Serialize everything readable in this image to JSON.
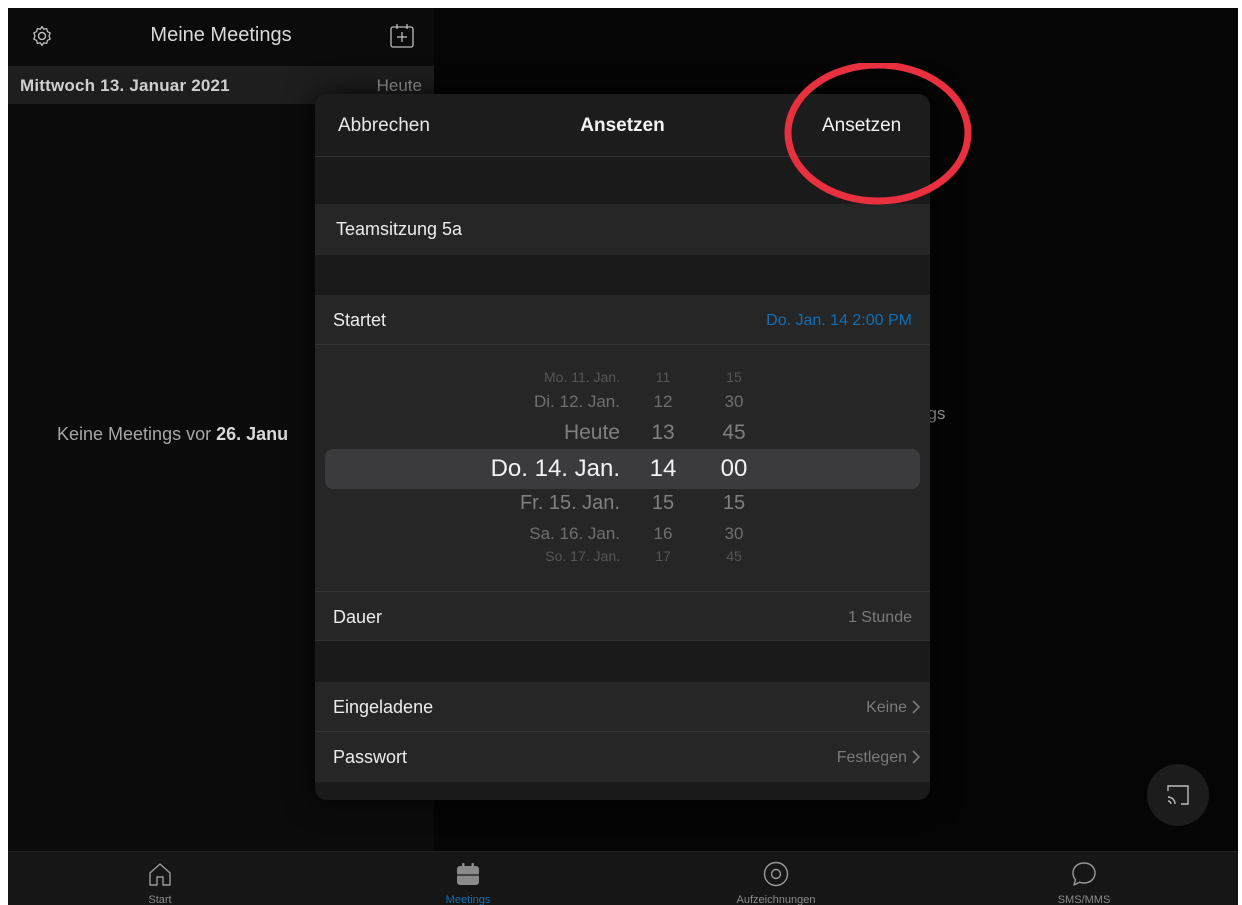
{
  "left_panel": {
    "title": "Meine Meetings",
    "date_header": "Mittwoch 13. Januar 2021",
    "today_label": "Heute",
    "empty_prefix": "Keine Meetings vor ",
    "empty_date": "26. Janu"
  },
  "right_panel": {
    "partial_text": "ngs"
  },
  "modal": {
    "cancel_label": "Abbrechen",
    "title": "Ansetzen",
    "confirm_label": "Ansetzen",
    "topic": "Teamsitzung 5a",
    "start_label": "Startet",
    "start_value": "Do. Jan. 14 2:00 PM",
    "picker": {
      "dates": [
        "Mo. 11. Jan.",
        "Di. 12. Jan.",
        "Heute",
        "Do. 14. Jan.",
        "Fr. 15. Jan.",
        "Sa. 16. Jan.",
        "So. 17. Jan."
      ],
      "hours": [
        "11",
        "12",
        "13",
        "14",
        "15",
        "16",
        "17"
      ],
      "minutes": [
        "15",
        "30",
        "45",
        "00",
        "15",
        "30",
        "45"
      ],
      "selected_index": 3
    },
    "duration_label": "Dauer",
    "duration_value": "1 Stunde",
    "invitees_label": "Eingeladene",
    "invitees_value": "Keine",
    "password_label": "Passwort",
    "password_value": "Festlegen"
  },
  "tabs": [
    {
      "label": "Start",
      "icon": "home-icon"
    },
    {
      "label": "Meetings",
      "icon": "calendar-icon",
      "active": true
    },
    {
      "label": "Aufzeichnungen",
      "icon": "record-icon"
    },
    {
      "label": "SMS/MMS",
      "icon": "chat-bubble-icon"
    }
  ],
  "colors": {
    "accent": "#0e6fb7",
    "annotation": "#e8303f",
    "background": "#050505"
  }
}
